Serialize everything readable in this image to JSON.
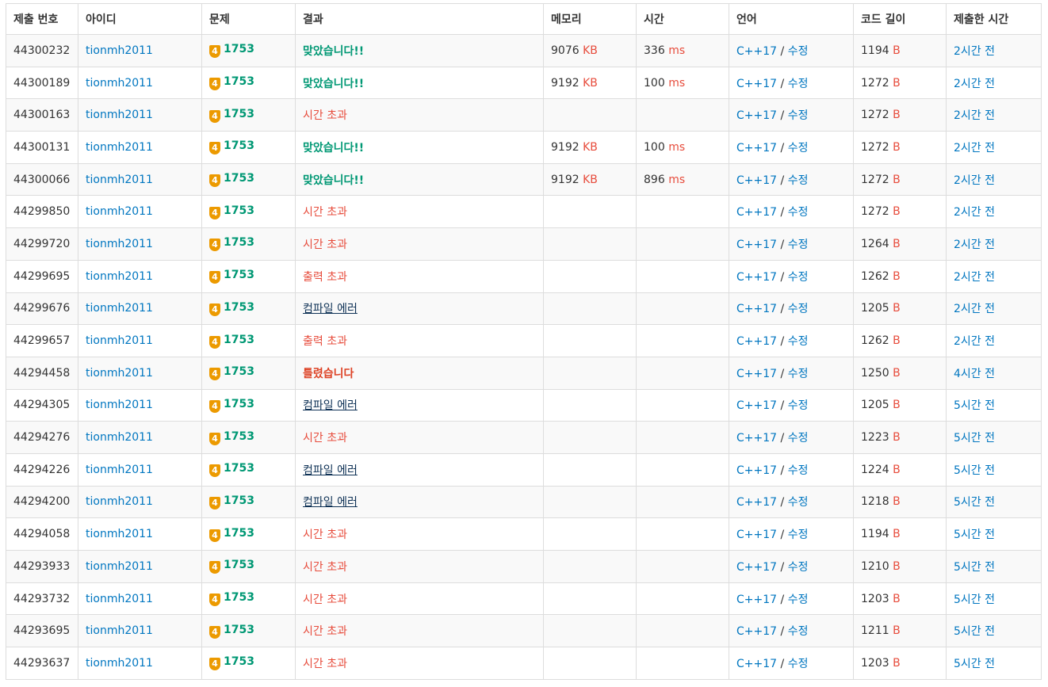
{
  "headers": [
    "제출 번호",
    "아이디",
    "문제",
    "결과",
    "메모리",
    "시간",
    "언어",
    "코드 길이",
    "제출한 시간"
  ],
  "units": {
    "memory": "KB",
    "time": "ms",
    "length": "B"
  },
  "colors": {
    "accepted": "#009874",
    "error": "#e74c3c",
    "link": "#0076c0",
    "tier": "#ec9a00"
  },
  "rows": [
    {
      "id": "44300232",
      "user": "tionmh2011",
      "tier": "4",
      "problem": "1753",
      "result": "맞았습니다!!",
      "rtype": "ac",
      "memory": "9076",
      "time": "336",
      "lang": "C++17",
      "edit": "수정",
      "length": "1194",
      "ago": "2시간 전"
    },
    {
      "id": "44300189",
      "user": "tionmh2011",
      "tier": "4",
      "problem": "1753",
      "result": "맞았습니다!!",
      "rtype": "ac",
      "memory": "9192",
      "time": "100",
      "lang": "C++17",
      "edit": "수정",
      "length": "1272",
      "ago": "2시간 전"
    },
    {
      "id": "44300163",
      "user": "tionmh2011",
      "tier": "4",
      "problem": "1753",
      "result": "시간 초과",
      "rtype": "tle",
      "memory": "",
      "time": "",
      "lang": "C++17",
      "edit": "수정",
      "length": "1272",
      "ago": "2시간 전"
    },
    {
      "id": "44300131",
      "user": "tionmh2011",
      "tier": "4",
      "problem": "1753",
      "result": "맞았습니다!!",
      "rtype": "ac",
      "memory": "9192",
      "time": "100",
      "lang": "C++17",
      "edit": "수정",
      "length": "1272",
      "ago": "2시간 전"
    },
    {
      "id": "44300066",
      "user": "tionmh2011",
      "tier": "4",
      "problem": "1753",
      "result": "맞았습니다!!",
      "rtype": "ac",
      "memory": "9192",
      "time": "896",
      "lang": "C++17",
      "edit": "수정",
      "length": "1272",
      "ago": "2시간 전"
    },
    {
      "id": "44299850",
      "user": "tionmh2011",
      "tier": "4",
      "problem": "1753",
      "result": "시간 초과",
      "rtype": "tle",
      "memory": "",
      "time": "",
      "lang": "C++17",
      "edit": "수정",
      "length": "1272",
      "ago": "2시간 전"
    },
    {
      "id": "44299720",
      "user": "tionmh2011",
      "tier": "4",
      "problem": "1753",
      "result": "시간 초과",
      "rtype": "tle",
      "memory": "",
      "time": "",
      "lang": "C++17",
      "edit": "수정",
      "length": "1264",
      "ago": "2시간 전"
    },
    {
      "id": "44299695",
      "user": "tionmh2011",
      "tier": "4",
      "problem": "1753",
      "result": "출력 초과",
      "rtype": "ole",
      "memory": "",
      "time": "",
      "lang": "C++17",
      "edit": "수정",
      "length": "1262",
      "ago": "2시간 전"
    },
    {
      "id": "44299676",
      "user": "tionmh2011",
      "tier": "4",
      "problem": "1753",
      "result": "컴파일 에러",
      "rtype": "ce",
      "memory": "",
      "time": "",
      "lang": "C++17",
      "edit": "수정",
      "length": "1205",
      "ago": "2시간 전"
    },
    {
      "id": "44299657",
      "user": "tionmh2011",
      "tier": "4",
      "problem": "1753",
      "result": "출력 초과",
      "rtype": "ole",
      "memory": "",
      "time": "",
      "lang": "C++17",
      "edit": "수정",
      "length": "1262",
      "ago": "2시간 전"
    },
    {
      "id": "44294458",
      "user": "tionmh2011",
      "tier": "4",
      "problem": "1753",
      "result": "틀렸습니다",
      "rtype": "wa",
      "memory": "",
      "time": "",
      "lang": "C++17",
      "edit": "수정",
      "length": "1250",
      "ago": "4시간 전"
    },
    {
      "id": "44294305",
      "user": "tionmh2011",
      "tier": "4",
      "problem": "1753",
      "result": "컴파일 에러",
      "rtype": "ce",
      "memory": "",
      "time": "",
      "lang": "C++17",
      "edit": "수정",
      "length": "1205",
      "ago": "5시간 전"
    },
    {
      "id": "44294276",
      "user": "tionmh2011",
      "tier": "4",
      "problem": "1753",
      "result": "시간 초과",
      "rtype": "tle",
      "memory": "",
      "time": "",
      "lang": "C++17",
      "edit": "수정",
      "length": "1223",
      "ago": "5시간 전"
    },
    {
      "id": "44294226",
      "user": "tionmh2011",
      "tier": "4",
      "problem": "1753",
      "result": "컴파일 에러",
      "rtype": "ce",
      "memory": "",
      "time": "",
      "lang": "C++17",
      "edit": "수정",
      "length": "1224",
      "ago": "5시간 전"
    },
    {
      "id": "44294200",
      "user": "tionmh2011",
      "tier": "4",
      "problem": "1753",
      "result": "컴파일 에러",
      "rtype": "ce",
      "memory": "",
      "time": "",
      "lang": "C++17",
      "edit": "수정",
      "length": "1218",
      "ago": "5시간 전"
    },
    {
      "id": "44294058",
      "user": "tionmh2011",
      "tier": "4",
      "problem": "1753",
      "result": "시간 초과",
      "rtype": "tle",
      "memory": "",
      "time": "",
      "lang": "C++17",
      "edit": "수정",
      "length": "1194",
      "ago": "5시간 전"
    },
    {
      "id": "44293933",
      "user": "tionmh2011",
      "tier": "4",
      "problem": "1753",
      "result": "시간 초과",
      "rtype": "tle",
      "memory": "",
      "time": "",
      "lang": "C++17",
      "edit": "수정",
      "length": "1210",
      "ago": "5시간 전"
    },
    {
      "id": "44293732",
      "user": "tionmh2011",
      "tier": "4",
      "problem": "1753",
      "result": "시간 초과",
      "rtype": "tle",
      "memory": "",
      "time": "",
      "lang": "C++17",
      "edit": "수정",
      "length": "1203",
      "ago": "5시간 전"
    },
    {
      "id": "44293695",
      "user": "tionmh2011",
      "tier": "4",
      "problem": "1753",
      "result": "시간 초과",
      "rtype": "tle",
      "memory": "",
      "time": "",
      "lang": "C++17",
      "edit": "수정",
      "length": "1211",
      "ago": "5시간 전"
    },
    {
      "id": "44293637",
      "user": "tionmh2011",
      "tier": "4",
      "problem": "1753",
      "result": "시간 초과",
      "rtype": "tle",
      "memory": "",
      "time": "",
      "lang": "C++17",
      "edit": "수정",
      "length": "1203",
      "ago": "5시간 전"
    }
  ]
}
